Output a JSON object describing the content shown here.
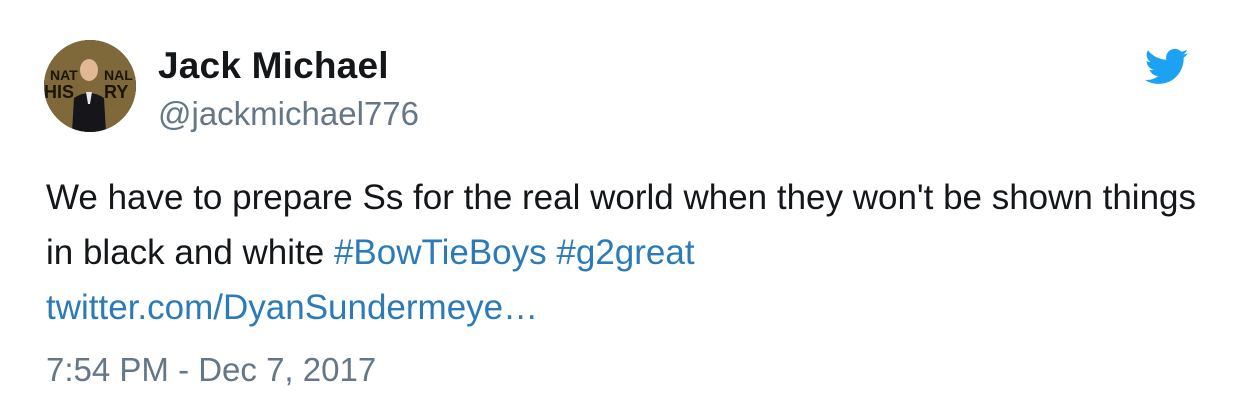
{
  "author": {
    "display_name": "Jack Michael",
    "handle": "@jackmichael776",
    "avatar_text": "NATIONAL HISTORY"
  },
  "tweet": {
    "text_part1": "We have to prepare Ss for the real world when they won't be shown things in black and white",
    "hashtags": [
      "#BowTieBoys",
      "#g2great"
    ],
    "link_text": "twitter.com/DyanSundermeye…",
    "timestamp": "7:54 PM - Dec 7, 2017"
  },
  "icons": {
    "platform": "twitter-bird-icon"
  },
  "colors": {
    "link": "#2b7bb9",
    "muted": "#657786",
    "text": "#14171a",
    "bird": "#1da1f2"
  }
}
